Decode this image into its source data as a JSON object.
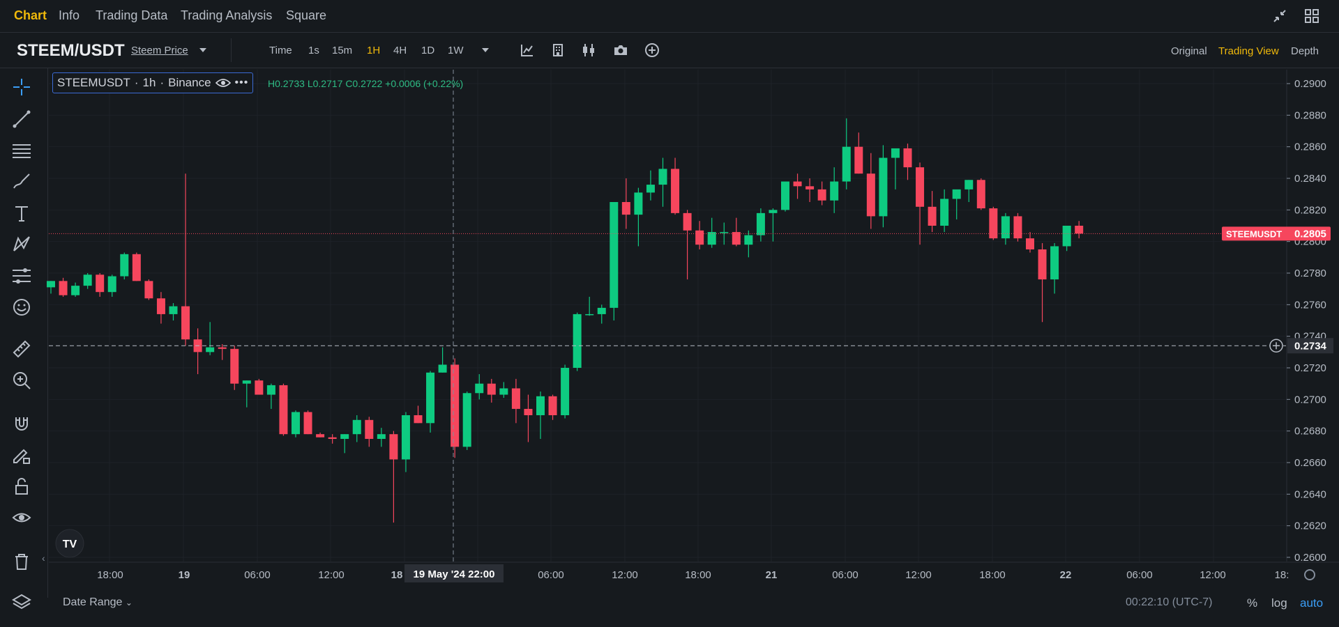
{
  "tabs": [
    {
      "label": "Chart",
      "active": true
    },
    {
      "label": "Info"
    },
    {
      "label": "Trading Data"
    },
    {
      "label": "Trading Analysis"
    },
    {
      "label": "Square"
    }
  ],
  "toolbar": {
    "pair": "STEEM/USDT",
    "price_link": "Steem Price",
    "intervals": [
      "Time",
      "1s",
      "15m",
      "1H",
      "4H",
      "1D",
      "1W"
    ],
    "active_interval": "1H",
    "views": [
      "Original",
      "Trading View",
      "Depth"
    ],
    "active_view": "Trading View"
  },
  "legend": {
    "symbol": "STEEMUSDT",
    "interval": "1h",
    "exchange": "Binance",
    "ohlc_text": "H0.2733  L0.2717  C0.2722  +0.0006 (+0.22%)"
  },
  "bottom": {
    "date_range": "Date Range",
    "clock": "00:22:10 (UTC-7)",
    "options": [
      "%",
      "log",
      "auto"
    ],
    "active_option": "auto"
  },
  "colors": {
    "up": "#0ecb81",
    "down": "#f6465d",
    "bg": "#161a1e",
    "accent": "#f0b90b"
  },
  "chart_data": {
    "type": "candlestick",
    "symbol": "STEEMUSDT",
    "interval": "1h",
    "ylim": [
      0.26,
      0.29
    ],
    "y_ticks": [
      "0.2900",
      "0.2880",
      "0.2860",
      "0.2840",
      "0.2820",
      "0.2800",
      "0.2780",
      "0.2760",
      "0.2740",
      "0.2720",
      "0.2700",
      "0.2680",
      "0.2660",
      "0.2640",
      "0.2620",
      "0.2600"
    ],
    "x_ticks": [
      "18:00",
      "19",
      "06:00",
      "12:00",
      "18",
      "06:00",
      "12:00",
      "18:00",
      "21",
      "06:00",
      "12:00",
      "18:00",
      "22",
      "06:00",
      "12:00",
      "18:"
    ],
    "crosshair_time": "19 May '24   22:00",
    "crosshair_price": "0.2734",
    "last_price_label": "STEEMUSDT",
    "last_price": "0.2805",
    "candles": [
      [
        0.2771,
        0.2775,
        0.2767,
        0.2775
      ],
      [
        0.2775,
        0.2777,
        0.2765,
        0.2766
      ],
      [
        0.2766,
        0.2774,
        0.2765,
        0.2772
      ],
      [
        0.2772,
        0.278,
        0.277,
        0.2779
      ],
      [
        0.2779,
        0.278,
        0.2765,
        0.2768
      ],
      [
        0.2768,
        0.2779,
        0.2765,
        0.2778
      ],
      [
        0.2778,
        0.2793,
        0.2776,
        0.2792
      ],
      [
        0.2792,
        0.2793,
        0.2775,
        0.2775
      ],
      [
        0.2775,
        0.2776,
        0.2763,
        0.2764
      ],
      [
        0.2764,
        0.2768,
        0.2748,
        0.2754
      ],
      [
        0.2754,
        0.2761,
        0.275,
        0.2759
      ],
      [
        0.2759,
        0.2843,
        0.2734,
        0.2738
      ],
      [
        0.2738,
        0.2745,
        0.2716,
        0.273
      ],
      [
        0.273,
        0.2749,
        0.2728,
        0.2733
      ],
      [
        0.2733,
        0.2735,
        0.2725,
        0.2732
      ],
      [
        0.2732,
        0.2734,
        0.2706,
        0.271
      ],
      [
        0.271,
        0.2712,
        0.2695,
        0.2712
      ],
      [
        0.2712,
        0.2713,
        0.2703,
        0.2703
      ],
      [
        0.2703,
        0.271,
        0.2694,
        0.2709
      ],
      [
        0.2709,
        0.271,
        0.2677,
        0.2678
      ],
      [
        0.2678,
        0.2693,
        0.2676,
        0.2692
      ],
      [
        0.2692,
        0.2693,
        0.2678,
        0.2678
      ],
      [
        0.2678,
        0.2679,
        0.2676,
        0.2676
      ],
      [
        0.2676,
        0.2678,
        0.2672,
        0.2675
      ],
      [
        0.2675,
        0.2678,
        0.2666,
        0.2678
      ],
      [
        0.2678,
        0.269,
        0.2673,
        0.2687
      ],
      [
        0.2687,
        0.2689,
        0.267,
        0.2675
      ],
      [
        0.2675,
        0.2682,
        0.267,
        0.2678
      ],
      [
        0.2678,
        0.268,
        0.2622,
        0.2662
      ],
      [
        0.2662,
        0.2692,
        0.2654,
        0.269
      ],
      [
        0.269,
        0.2696,
        0.2685,
        0.2685
      ],
      [
        0.2685,
        0.2718,
        0.2679,
        0.2717
      ],
      [
        0.2717,
        0.2733,
        0.2717,
        0.2722
      ],
      [
        0.2722,
        0.2726,
        0.2663,
        0.267
      ],
      [
        0.267,
        0.2705,
        0.2668,
        0.2704
      ],
      [
        0.2704,
        0.2716,
        0.27,
        0.271
      ],
      [
        0.271,
        0.2713,
        0.2698,
        0.2703
      ],
      [
        0.2703,
        0.2711,
        0.2701,
        0.2707
      ],
      [
        0.2707,
        0.2713,
        0.2685,
        0.2694
      ],
      [
        0.2694,
        0.2703,
        0.2673,
        0.269
      ],
      [
        0.269,
        0.2705,
        0.2675,
        0.2702
      ],
      [
        0.2702,
        0.2703,
        0.2687,
        0.269
      ],
      [
        0.269,
        0.2722,
        0.2688,
        0.272
      ],
      [
        0.272,
        0.2755,
        0.2718,
        0.2754
      ],
      [
        0.2754,
        0.2765,
        0.2753,
        0.2754
      ],
      [
        0.2754,
        0.276,
        0.2748,
        0.2758
      ],
      [
        0.2758,
        0.2825,
        0.275,
        0.2825
      ],
      [
        0.2825,
        0.284,
        0.2808,
        0.2817
      ],
      [
        0.2817,
        0.2834,
        0.2797,
        0.2831
      ],
      [
        0.2831,
        0.2845,
        0.2826,
        0.2836
      ],
      [
        0.2836,
        0.2853,
        0.2822,
        0.2846
      ],
      [
        0.2846,
        0.2853,
        0.2817,
        0.2818
      ],
      [
        0.2818,
        0.282,
        0.2776,
        0.2807
      ],
      [
        0.2807,
        0.2813,
        0.2795,
        0.2798
      ],
      [
        0.2798,
        0.2815,
        0.2796,
        0.2806
      ],
      [
        0.2806,
        0.2812,
        0.2798,
        0.2806
      ],
      [
        0.2806,
        0.2815,
        0.2797,
        0.2798
      ],
      [
        0.2798,
        0.2807,
        0.279,
        0.2804
      ],
      [
        0.2804,
        0.2821,
        0.28,
        0.2818
      ],
      [
        0.2818,
        0.2821,
        0.28,
        0.282
      ],
      [
        0.282,
        0.2837,
        0.2819,
        0.2838
      ],
      [
        0.2838,
        0.2843,
        0.2827,
        0.2835
      ],
      [
        0.2835,
        0.284,
        0.2825,
        0.2833
      ],
      [
        0.2833,
        0.2838,
        0.2823,
        0.2826
      ],
      [
        0.2826,
        0.2847,
        0.2818,
        0.2838
      ],
      [
        0.2838,
        0.2878,
        0.2833,
        0.286
      ],
      [
        0.286,
        0.2869,
        0.2843,
        0.2843
      ],
      [
        0.2843,
        0.2856,
        0.2808,
        0.2816
      ],
      [
        0.2816,
        0.2861,
        0.2809,
        0.2853
      ],
      [
        0.2853,
        0.2857,
        0.2833,
        0.2859
      ],
      [
        0.2859,
        0.2862,
        0.2839,
        0.2847
      ],
      [
        0.2847,
        0.285,
        0.2798,
        0.2822
      ],
      [
        0.2822,
        0.2832,
        0.2806,
        0.281
      ],
      [
        0.281,
        0.2833,
        0.2806,
        0.2827
      ],
      [
        0.2827,
        0.2829,
        0.2814,
        0.2833
      ],
      [
        0.2833,
        0.2839,
        0.2825,
        0.2839
      ],
      [
        0.2839,
        0.284,
        0.282,
        0.2821
      ],
      [
        0.2821,
        0.2822,
        0.2801,
        0.2802
      ],
      [
        0.2802,
        0.2818,
        0.2798,
        0.2816
      ],
      [
        0.2816,
        0.2818,
        0.28,
        0.2802
      ],
      [
        0.2802,
        0.2806,
        0.2793,
        0.2795
      ],
      [
        0.2795,
        0.2799,
        0.2749,
        0.2776
      ],
      [
        0.2776,
        0.2799,
        0.2767,
        0.2797
      ],
      [
        0.2797,
        0.2809,
        0.2794,
        0.281
      ],
      [
        0.281,
        0.2813,
        0.2802,
        0.2805
      ]
    ]
  }
}
